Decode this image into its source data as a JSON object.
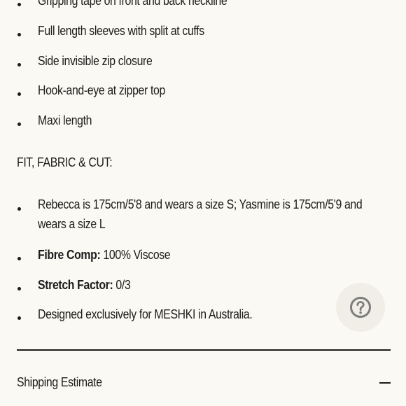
{
  "details_list": [
    {
      "text": "Gripping tape on front and back neckline"
    },
    {
      "text": "Full length sleeves with split at cuffs"
    },
    {
      "text": "Side invisible zip closure"
    },
    {
      "text": "Hook-and-eye at zipper top"
    },
    {
      "text": "Maxi length"
    }
  ],
  "fit_section": {
    "heading": "FIT, FABRIC & CUT:",
    "items": [
      {
        "label": "",
        "text": "Rebecca is 175cm/5'8 and wears a size S; Yasmine is 175cm/5'9 and wears a size L"
      },
      {
        "label": "Fibre Comp:",
        "text": " 100% Viscose"
      },
      {
        "label": "Stretch Factor:",
        "text": " 0/3"
      },
      {
        "label": "",
        "text": "Designed exclusively for MESHKI in Australia."
      }
    ]
  },
  "accordion": {
    "title": "Shipping Estimate",
    "state": "expanded",
    "toggle_icon": "minus-icon"
  },
  "help_button": {
    "icon": "question-mark-icon",
    "background": "#f0eee6"
  },
  "colors": {
    "page_background": "#fbf9f3",
    "text": "#1c1c1c"
  }
}
